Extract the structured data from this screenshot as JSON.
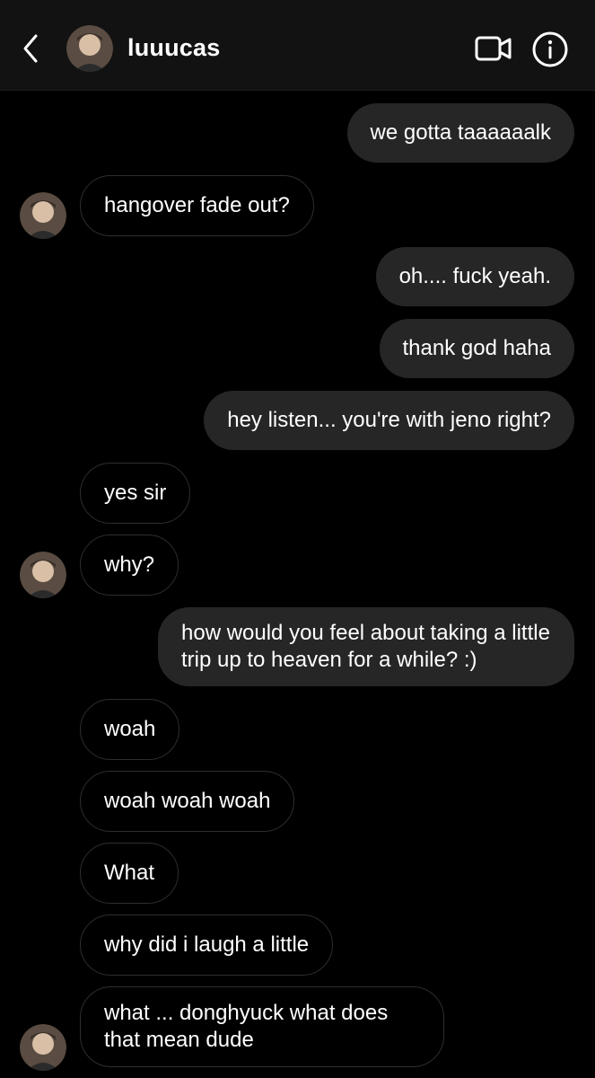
{
  "header": {
    "username": "luuucas",
    "back_icon": "chevron-left-icon",
    "video_icon": "video-camera-icon",
    "info_icon": "info-icon"
  },
  "messages": [
    {
      "side": "out",
      "text": "we gotta taaaaaalk"
    },
    {
      "side": "in",
      "text": "hangover fade out?"
    },
    {
      "side": "out",
      "text": "oh.... fuck yeah."
    },
    {
      "side": "out",
      "text": "thank god haha"
    },
    {
      "side": "out",
      "text": "hey listen... you're with jeno right?"
    },
    {
      "side": "in",
      "text": "yes sir"
    },
    {
      "side": "in",
      "text": "why?"
    },
    {
      "side": "out",
      "text": "how would you feel about taking a little trip up to heaven for a while? :)"
    },
    {
      "side": "in",
      "text": "woah"
    },
    {
      "side": "in",
      "text": "woah woah woah"
    },
    {
      "side": "in",
      "text": "What"
    },
    {
      "side": "in",
      "text": "why did i laugh a little"
    },
    {
      "side": "in",
      "text": "what ... donghyuck what does that mean dude"
    }
  ],
  "colors": {
    "background": "#000000",
    "header_bg": "#121212",
    "outgoing_bubble": "#262626",
    "incoming_border": "#2e2e2e",
    "text": "#ffffff"
  }
}
